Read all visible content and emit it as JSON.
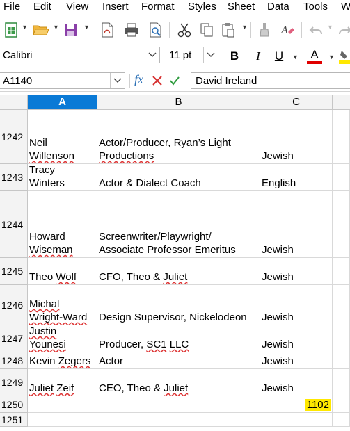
{
  "menu": [
    "File",
    "Edit",
    "View",
    "Insert",
    "Format",
    "Styles",
    "Sheet",
    "Data",
    "Tools",
    "W"
  ],
  "format": {
    "font_name": "Calibri",
    "font_size": "11 pt",
    "bold": "B",
    "italic": "I",
    "underline": "U",
    "font_color": "A"
  },
  "formula_bar": {
    "cell_ref": "A1140",
    "fx": "fx",
    "content": "David Ireland"
  },
  "columns": [
    "A",
    "B",
    "C"
  ],
  "rows": [
    {
      "num": "1242",
      "a": [
        "Neil",
        "Willenson"
      ],
      "b": [
        "Actor/Producer, Ryan’s Light",
        "Productions"
      ],
      "c": "Jewish"
    },
    {
      "num": "1243",
      "a": [
        "Tracy",
        "Winters"
      ],
      "b": [
        "Actor & Dialect Coach"
      ],
      "c": "English"
    },
    {
      "num": "1244",
      "a": [
        "Howard",
        "Wiseman"
      ],
      "b": [
        "Screenwriter/Playwright/",
        "Associate Professor Emeritus"
      ],
      "c": "Jewish"
    },
    {
      "num": "1245",
      "a": [
        "Theo Wolf"
      ],
      "b": [
        "CFO, Theo & Juliet"
      ],
      "c": "Jewish"
    },
    {
      "num": "1246",
      "a": [
        "Michal",
        "Wright-Ward"
      ],
      "b": [
        "Design Supervisor, Nickelodeon"
      ],
      "c": "Jewish"
    },
    {
      "num": "1247",
      "a": [
        "Justin",
        "Younesi"
      ],
      "b": [
        "Producer, SC1 LLC"
      ],
      "c": "Jewish"
    },
    {
      "num": "1248",
      "a": [
        "Kevin Zegers"
      ],
      "b": [
        "Actor"
      ],
      "c": "Jewish"
    },
    {
      "num": "1249",
      "a": [
        "Juliet Zeif"
      ],
      "b": [
        "CEO, Theo & Juliet"
      ],
      "c": "Jewish"
    },
    {
      "num": "1250",
      "a": [],
      "b": [],
      "c": "1102"
    },
    {
      "num": "1251",
      "a": [],
      "b": [],
      "c": ""
    }
  ],
  "colors": {
    "selected_header": "#0a7ad6",
    "highlight": "#ffe800",
    "spell_error": "#dd3333",
    "font_color_bar": "#e00000"
  },
  "icons": [
    "new-spreadsheet-icon",
    "open-folder-icon",
    "save-icon",
    "export-pdf-icon",
    "print-icon",
    "print-preview-icon",
    "cut-icon",
    "copy-icon",
    "paste-icon",
    "clone-format-icon",
    "clear-format-icon",
    "undo-icon",
    "redo-icon"
  ]
}
